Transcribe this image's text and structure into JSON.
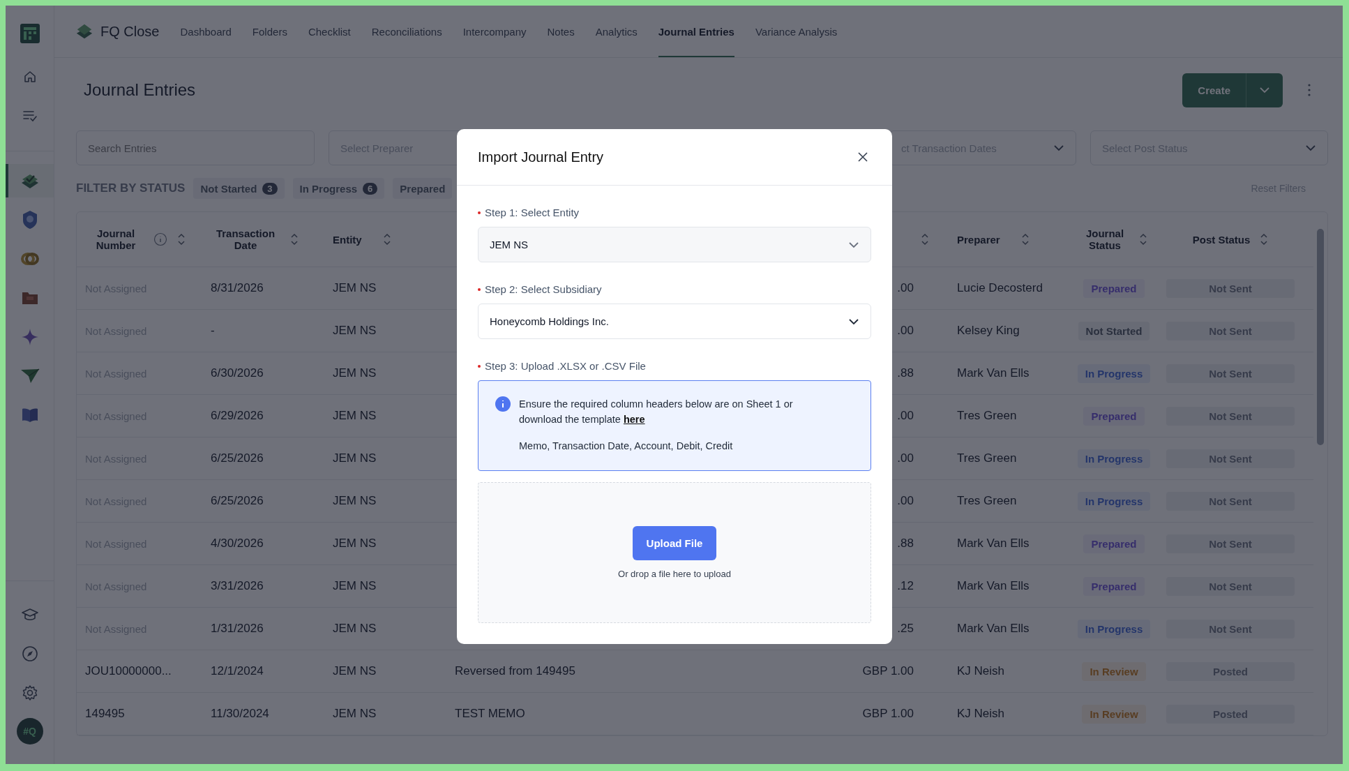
{
  "sidebar": {
    "top": [
      {
        "kind": "home"
      },
      {
        "kind": "tasks"
      }
    ],
    "apps": [
      {
        "kind": "stack",
        "selected": true
      },
      {
        "kind": "badge",
        "selected": false
      },
      {
        "kind": "rings",
        "selected": false
      },
      {
        "kind": "folder",
        "selected": false
      },
      {
        "kind": "sparkle",
        "selected": false
      },
      {
        "kind": "plane",
        "selected": false
      },
      {
        "kind": "book",
        "selected": false
      }
    ],
    "bottom": [
      {
        "kind": "cap"
      },
      {
        "kind": "compass"
      },
      {
        "kind": "gear"
      }
    ],
    "avatar": "#Q"
  },
  "app_name": "FQ Close",
  "tabs": [
    {
      "label": "Dashboard",
      "selected": false
    },
    {
      "label": "Folders",
      "selected": false
    },
    {
      "label": "Checklist",
      "selected": false
    },
    {
      "label": "Reconciliations",
      "selected": false
    },
    {
      "label": "Intercompany",
      "selected": false
    },
    {
      "label": "Notes",
      "selected": false
    },
    {
      "label": "Analytics",
      "selected": false
    },
    {
      "label": "Journal Entries",
      "selected": true
    },
    {
      "label": "Variance Analysis",
      "selected": false
    }
  ],
  "page_title": "Journal Entries",
  "create_button": "Create",
  "filters": {
    "search": {
      "placeholder": "Search Entries"
    },
    "preparer": {
      "placeholder": "Select Preparer"
    },
    "dates": {
      "placeholder": "ct Transaction Dates"
    },
    "post_status": {
      "placeholder": "Select Post Status"
    }
  },
  "status_filter": {
    "label": "FILTER BY STATUS",
    "chips": [
      {
        "label": "Not Started",
        "count": "3"
      },
      {
        "label": "In Progress",
        "count": "6"
      },
      {
        "label": "Prepared"
      }
    ],
    "reset": "Reset Filters"
  },
  "table": {
    "columns": [
      "Journal Number",
      "Transaction Date",
      "Entity",
      "Preparer",
      "Journal Status",
      "Post Status"
    ],
    "rows": [
      {
        "number": "Not Assigned",
        "assigned": false,
        "date": "8/31/2026",
        "entity": "JEM NS",
        "amount": ".00",
        "preparer": "Lucie Decosterd",
        "journal_status": {
          "label": "Prepared",
          "kind": "prepared"
        },
        "post_status": "Not Sent"
      },
      {
        "number": "Not Assigned",
        "assigned": false,
        "date": "-",
        "entity": "JEM NS",
        "amount": ".00",
        "preparer": "Kelsey King",
        "journal_status": {
          "label": "Not Started",
          "kind": "not_started"
        },
        "post_status": "Not Sent"
      },
      {
        "number": "Not Assigned",
        "assigned": false,
        "date": "6/30/2026",
        "entity": "JEM NS",
        "amount": ".88",
        "preparer": "Mark Van Ells",
        "journal_status": {
          "label": "In Progress",
          "kind": "in_progress"
        },
        "post_status": "Not Sent"
      },
      {
        "number": "Not Assigned",
        "assigned": false,
        "date": "6/29/2026",
        "entity": "JEM NS",
        "amount": ".00",
        "preparer": "Tres Green",
        "journal_status": {
          "label": "Prepared",
          "kind": "prepared"
        },
        "post_status": "Not Sent"
      },
      {
        "number": "Not Assigned",
        "assigned": false,
        "date": "6/25/2026",
        "entity": "JEM NS",
        "amount": ".00",
        "preparer": "Tres Green",
        "journal_status": {
          "label": "In Progress",
          "kind": "in_progress"
        },
        "post_status": "Not Sent"
      },
      {
        "number": "Not Assigned",
        "assigned": false,
        "date": "6/25/2026",
        "entity": "JEM NS",
        "amount": ".00",
        "preparer": "Tres Green",
        "journal_status": {
          "label": "In Progress",
          "kind": "in_progress"
        },
        "post_status": "Not Sent"
      },
      {
        "number": "Not Assigned",
        "assigned": false,
        "date": "4/30/2026",
        "entity": "JEM NS",
        "amount": ".88",
        "preparer": "Mark Van Ells",
        "journal_status": {
          "label": "Prepared",
          "kind": "prepared"
        },
        "post_status": "Not Sent"
      },
      {
        "number": "Not Assigned",
        "assigned": false,
        "date": "3/31/2026",
        "entity": "JEM NS",
        "amount": ".12",
        "preparer": "Mark Van Ells",
        "journal_status": {
          "label": "Prepared",
          "kind": "prepared"
        },
        "post_status": "Not Sent"
      },
      {
        "number": "Not Assigned",
        "assigned": false,
        "date": "1/31/2026",
        "entity": "JEM NS",
        "amount": ".25",
        "preparer": "Mark Van Ells",
        "journal_status": {
          "label": "In Progress",
          "kind": "in_progress"
        },
        "post_status": "Not Sent"
      },
      {
        "number": "JOU10000000...",
        "assigned": true,
        "date": "12/1/2024",
        "entity": "JEM NS",
        "memo": "Reversed from 149495",
        "amount": "GBP 1.00",
        "preparer": "KJ Neish",
        "journal_status": {
          "label": "In Review",
          "kind": "in_review"
        },
        "post_status": "Posted"
      },
      {
        "number": "149495",
        "assigned": true,
        "date": "11/30/2024",
        "entity": "JEM NS",
        "memo": "TEST MEMO",
        "amount": "GBP 1.00",
        "preparer": "KJ Neish",
        "journal_status": {
          "label": "In Review",
          "kind": "in_review"
        },
        "post_status": "Posted"
      }
    ]
  },
  "modal": {
    "title": "Import Journal Entry",
    "steps": [
      {
        "label": "Step 1: Select Entity",
        "required": true,
        "kind": "select",
        "value": "JEM NS",
        "disabled": true
      },
      {
        "label": "Step 2: Select Subsidiary",
        "required": true,
        "kind": "select",
        "value": "Honeycomb Holdings Inc.",
        "disabled": false
      },
      {
        "label": "Step 3: Upload .XLSX or .CSV File",
        "required": true,
        "kind": "upload"
      }
    ],
    "info": {
      "text": "Ensure the required column headers below are on Sheet 1 or download the template ",
      "link": "here",
      "columns": "Memo, Transaction Date, Account, Debit, Credit"
    },
    "upload_button": "Upload File",
    "drop_hint": "Or drop a file here to upload"
  }
}
